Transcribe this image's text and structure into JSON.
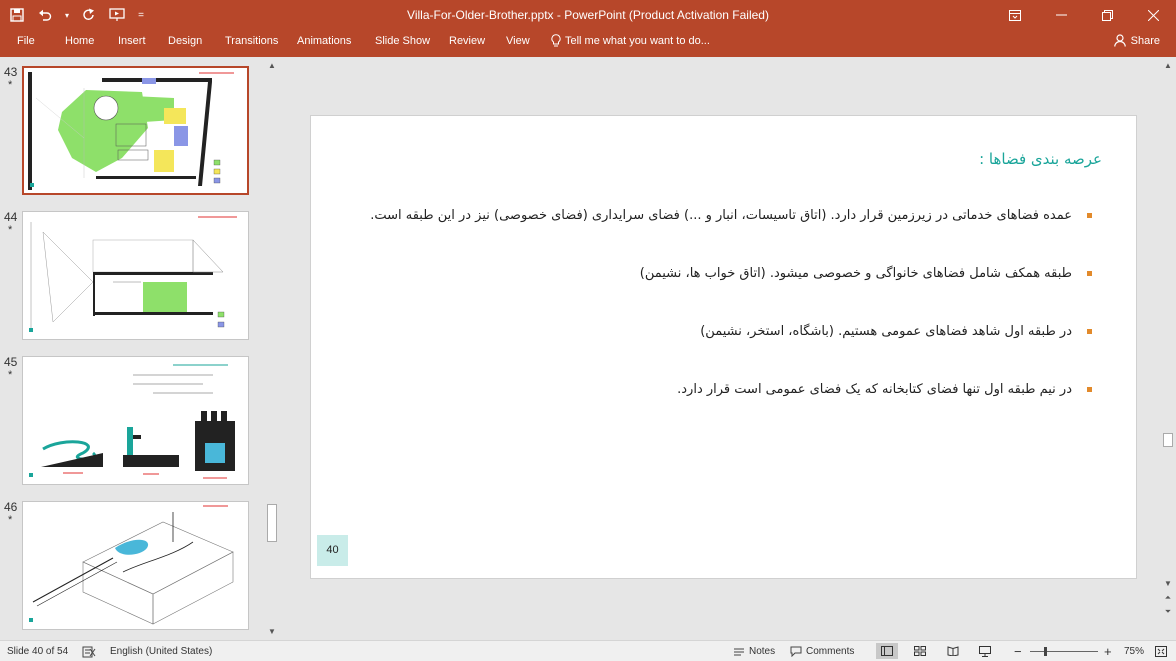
{
  "window": {
    "title": "Villa-For-Older-Brother.pptx - PowerPoint (Product Activation Failed)",
    "accent": "#b7472a"
  },
  "quick_access": {
    "customize": "="
  },
  "ribbon": {
    "tabs": [
      "File",
      "Home",
      "Insert",
      "Design",
      "Transitions",
      "Animations",
      "Slide Show",
      "Review",
      "View"
    ],
    "tell_me": "Tell me what you want to do...",
    "share": "Share"
  },
  "thumbnails": [
    {
      "number": "43",
      "star": "*"
    },
    {
      "number": "44",
      "star": "*"
    },
    {
      "number": "45",
      "star": "*"
    },
    {
      "number": "46",
      "star": "*"
    }
  ],
  "slide": {
    "title": "عرصه بندی فضاها :",
    "bullets": [
      "عمده فضاهای خدماتی در زیرزمین قرار دارد. (اتاق تاسیسات، انبار و ...) فضای سرایداری (فضای خصوصی) نیز در این طبقه است.",
      "طبقه همکف شامل فضاهای خانواگی و خصوصی میشود. (اتاق خواب ها، نشیمن)",
      "در طبقه اول شاهد فضاهای عمومی هستیم. (باشگاه، استخر، نشیمن)",
      "در نیم طبقه اول تنها فضای کتابخانه که یک فضای عمومی است قرار دارد."
    ],
    "number": "40",
    "title_color": "#1aa59a",
    "bullet_color": "#e28a2b"
  },
  "status": {
    "slide_info": "Slide 40 of 54",
    "language": "English (United States)",
    "notes": "Notes",
    "comments": "Comments",
    "zoom_minus": "−",
    "zoom_plus": "+",
    "zoom": "75%"
  }
}
